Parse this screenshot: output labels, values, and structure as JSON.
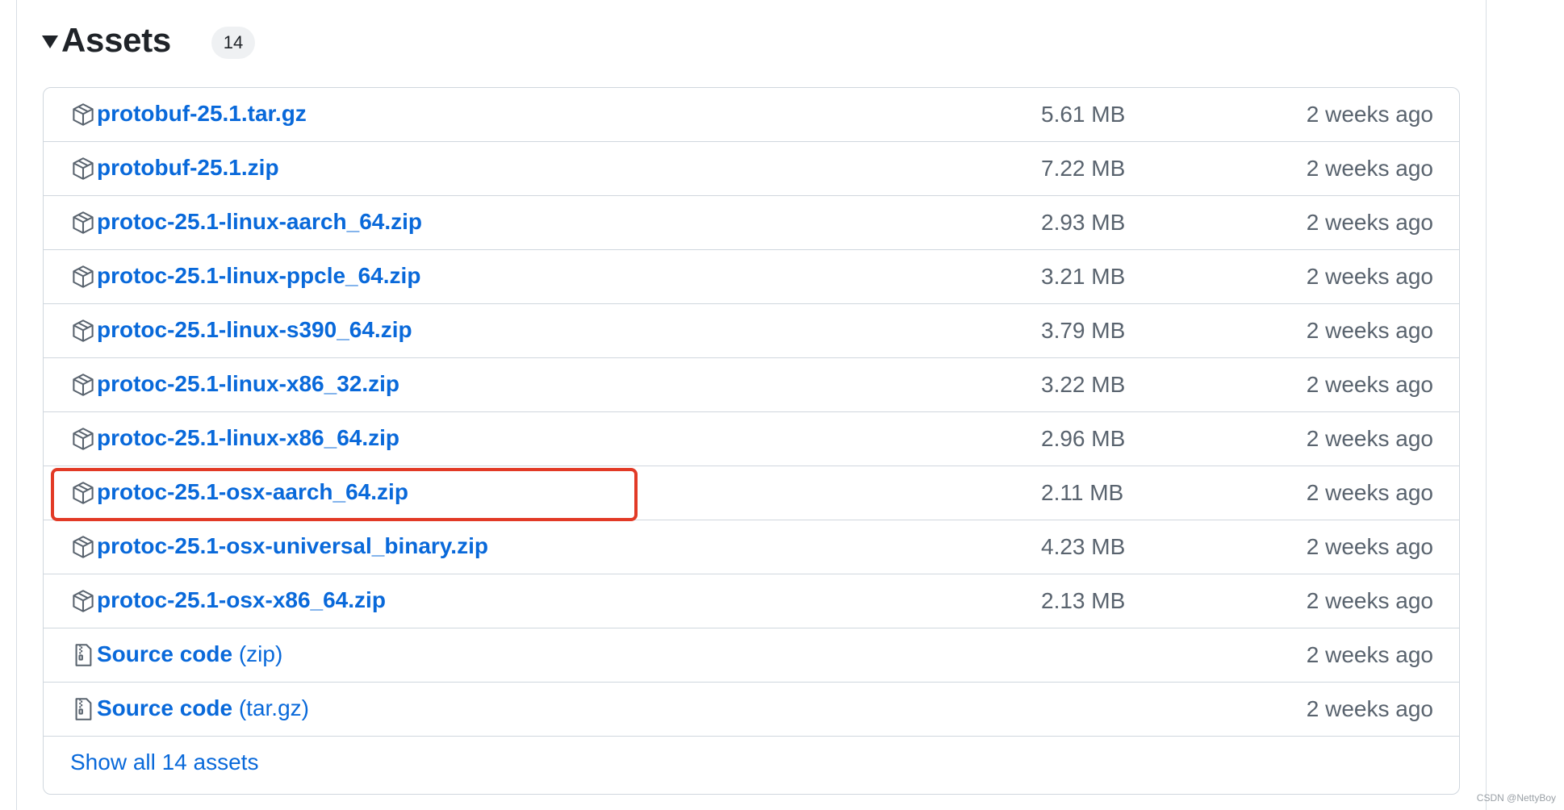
{
  "assets": {
    "title": "Assets",
    "count": "14",
    "items": [
      {
        "name": "protobuf-25.1.tar.gz",
        "suffix": "",
        "size": "5.61 MB",
        "date": "2 weeks ago",
        "icon": "package-icon"
      },
      {
        "name": "protobuf-25.1.zip",
        "suffix": "",
        "size": "7.22 MB",
        "date": "2 weeks ago",
        "icon": "package-icon"
      },
      {
        "name": "protoc-25.1-linux-aarch_64.zip",
        "suffix": "",
        "size": "2.93 MB",
        "date": "2 weeks ago",
        "icon": "package-icon"
      },
      {
        "name": "protoc-25.1-linux-ppcle_64.zip",
        "suffix": "",
        "size": "3.21 MB",
        "date": "2 weeks ago",
        "icon": "package-icon"
      },
      {
        "name": "protoc-25.1-linux-s390_64.zip",
        "suffix": "",
        "size": "3.79 MB",
        "date": "2 weeks ago",
        "icon": "package-icon"
      },
      {
        "name": "protoc-25.1-linux-x86_32.zip",
        "suffix": "",
        "size": "3.22 MB",
        "date": "2 weeks ago",
        "icon": "package-icon"
      },
      {
        "name": "protoc-25.1-linux-x86_64.zip",
        "suffix": "",
        "size": "2.96 MB",
        "date": "2 weeks ago",
        "icon": "package-icon"
      },
      {
        "name": "protoc-25.1-osx-aarch_64.zip",
        "suffix": "",
        "size": "2.11 MB",
        "date": "2 weeks ago",
        "icon": "package-icon"
      },
      {
        "name": "protoc-25.1-osx-universal_binary.zip",
        "suffix": "",
        "size": "4.23 MB",
        "date": "2 weeks ago",
        "icon": "package-icon"
      },
      {
        "name": "protoc-25.1-osx-x86_64.zip",
        "suffix": "",
        "size": "2.13 MB",
        "date": "2 weeks ago",
        "icon": "package-icon"
      },
      {
        "name": "Source code",
        "suffix": " (zip)",
        "size": "",
        "date": "2 weeks ago",
        "icon": "file-zip-icon"
      },
      {
        "name": "Source code",
        "suffix": " (tar.gz)",
        "size": "",
        "date": "2 weeks ago",
        "icon": "file-zip-icon"
      }
    ],
    "show_all_label": "Show all 14 assets"
  },
  "highlight": {
    "color": "#e23a26",
    "target": "protoc-25.1-osx-aarch_64.zip"
  },
  "colors": {
    "link": "#0969da",
    "muted": "#59636e",
    "border": "#d0d7de",
    "text": "#1f2328"
  },
  "watermark": "CSDN @NettyBoy"
}
